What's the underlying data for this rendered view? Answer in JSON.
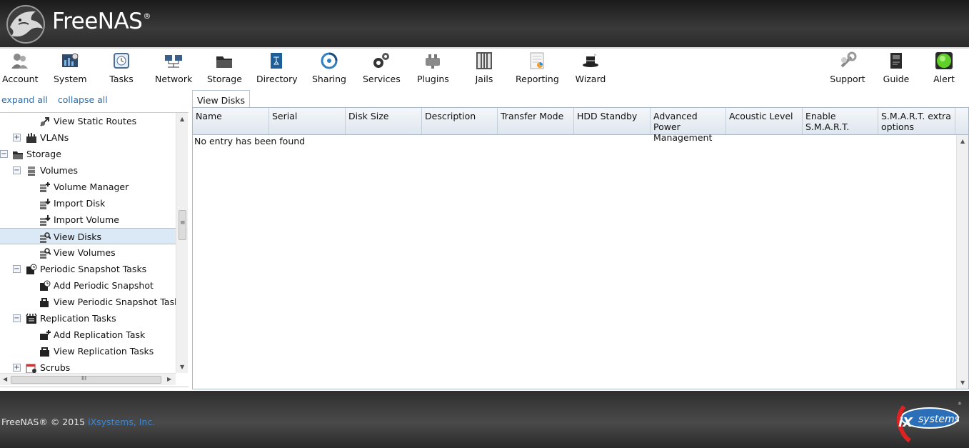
{
  "header": {
    "app_name": "FreeNAS",
    "trademark": "®"
  },
  "toolbar": {
    "items": [
      {
        "label": "Account",
        "icon": "account-icon"
      },
      {
        "label": "System",
        "icon": "system-icon"
      },
      {
        "label": "Tasks",
        "icon": "tasks-icon"
      },
      {
        "label": "Network",
        "icon": "network-icon"
      },
      {
        "label": "Storage",
        "icon": "storage-icon"
      },
      {
        "label": "Directory",
        "icon": "directory-icon"
      },
      {
        "label": "Sharing",
        "icon": "sharing-icon"
      },
      {
        "label": "Services",
        "icon": "services-icon"
      },
      {
        "label": "Plugins",
        "icon": "plugins-icon"
      },
      {
        "label": "Jails",
        "icon": "jails-icon"
      },
      {
        "label": "Reporting",
        "icon": "reporting-icon"
      },
      {
        "label": "Wizard",
        "icon": "wizard-icon"
      },
      {
        "label": "Support",
        "icon": "support-icon"
      },
      {
        "label": "Guide",
        "icon": "guide-icon"
      },
      {
        "label": "Alert",
        "icon": "alert-icon"
      }
    ]
  },
  "tree": {
    "expand_all": "expand all",
    "collapse_all": "collapse all",
    "nodes": [
      {
        "label": "View Static Routes",
        "icon": "view-static-routes-icon"
      },
      {
        "label": "VLANs",
        "icon": "vlans-icon",
        "expander": "+"
      },
      {
        "label": "Storage",
        "icon": "storage-folder-icon",
        "expander": "−"
      },
      {
        "label": "Volumes",
        "icon": "volumes-icon",
        "expander": "−"
      },
      {
        "label": "Volume Manager",
        "icon": "volume-manager-icon"
      },
      {
        "label": "Import Disk",
        "icon": "import-disk-icon"
      },
      {
        "label": "Import Volume",
        "icon": "import-volume-icon"
      },
      {
        "label": "View Disks",
        "icon": "view-disks-icon",
        "selected": true
      },
      {
        "label": "View Volumes",
        "icon": "view-volumes-icon"
      },
      {
        "label": "Periodic Snapshot Tasks",
        "icon": "periodic-snapshot-icon",
        "expander": "−"
      },
      {
        "label": "Add Periodic Snapshot",
        "icon": "add-periodic-snapshot-icon"
      },
      {
        "label": "View Periodic Snapshot Tasks",
        "icon": "view-periodic-snapshot-icon"
      },
      {
        "label": "Replication Tasks",
        "icon": "replication-tasks-icon",
        "expander": "−"
      },
      {
        "label": "Add Replication Task",
        "icon": "add-replication-icon"
      },
      {
        "label": "View Replication Tasks",
        "icon": "view-replication-icon"
      },
      {
        "label": "Scrubs",
        "icon": "scrubs-icon",
        "expander": "+"
      }
    ],
    "h_scroll_grip": "III",
    "v_scroll_grip": "≡"
  },
  "content": {
    "tab_label": "View Disks",
    "columns": [
      "Name",
      "Serial",
      "Disk Size",
      "Description",
      "Transfer Mode",
      "HDD Standby",
      "Advanced Power Management",
      "Acoustic Level",
      "Enable S.M.A.R.T.",
      "S.M.A.R.T. extra options"
    ],
    "empty_message": "No entry has been found"
  },
  "footer": {
    "copyright_prefix": "FreeNAS® © 2015",
    "company_link": "iXsystems, Inc.",
    "ix_logo_text": "systems",
    "ix_logo_mark": "iX"
  },
  "colors": {
    "header_bg": "#2b2b2b",
    "link": "#2b6fb5",
    "selection": "#dbe8f6",
    "alert_green": "#5fcf2a"
  }
}
